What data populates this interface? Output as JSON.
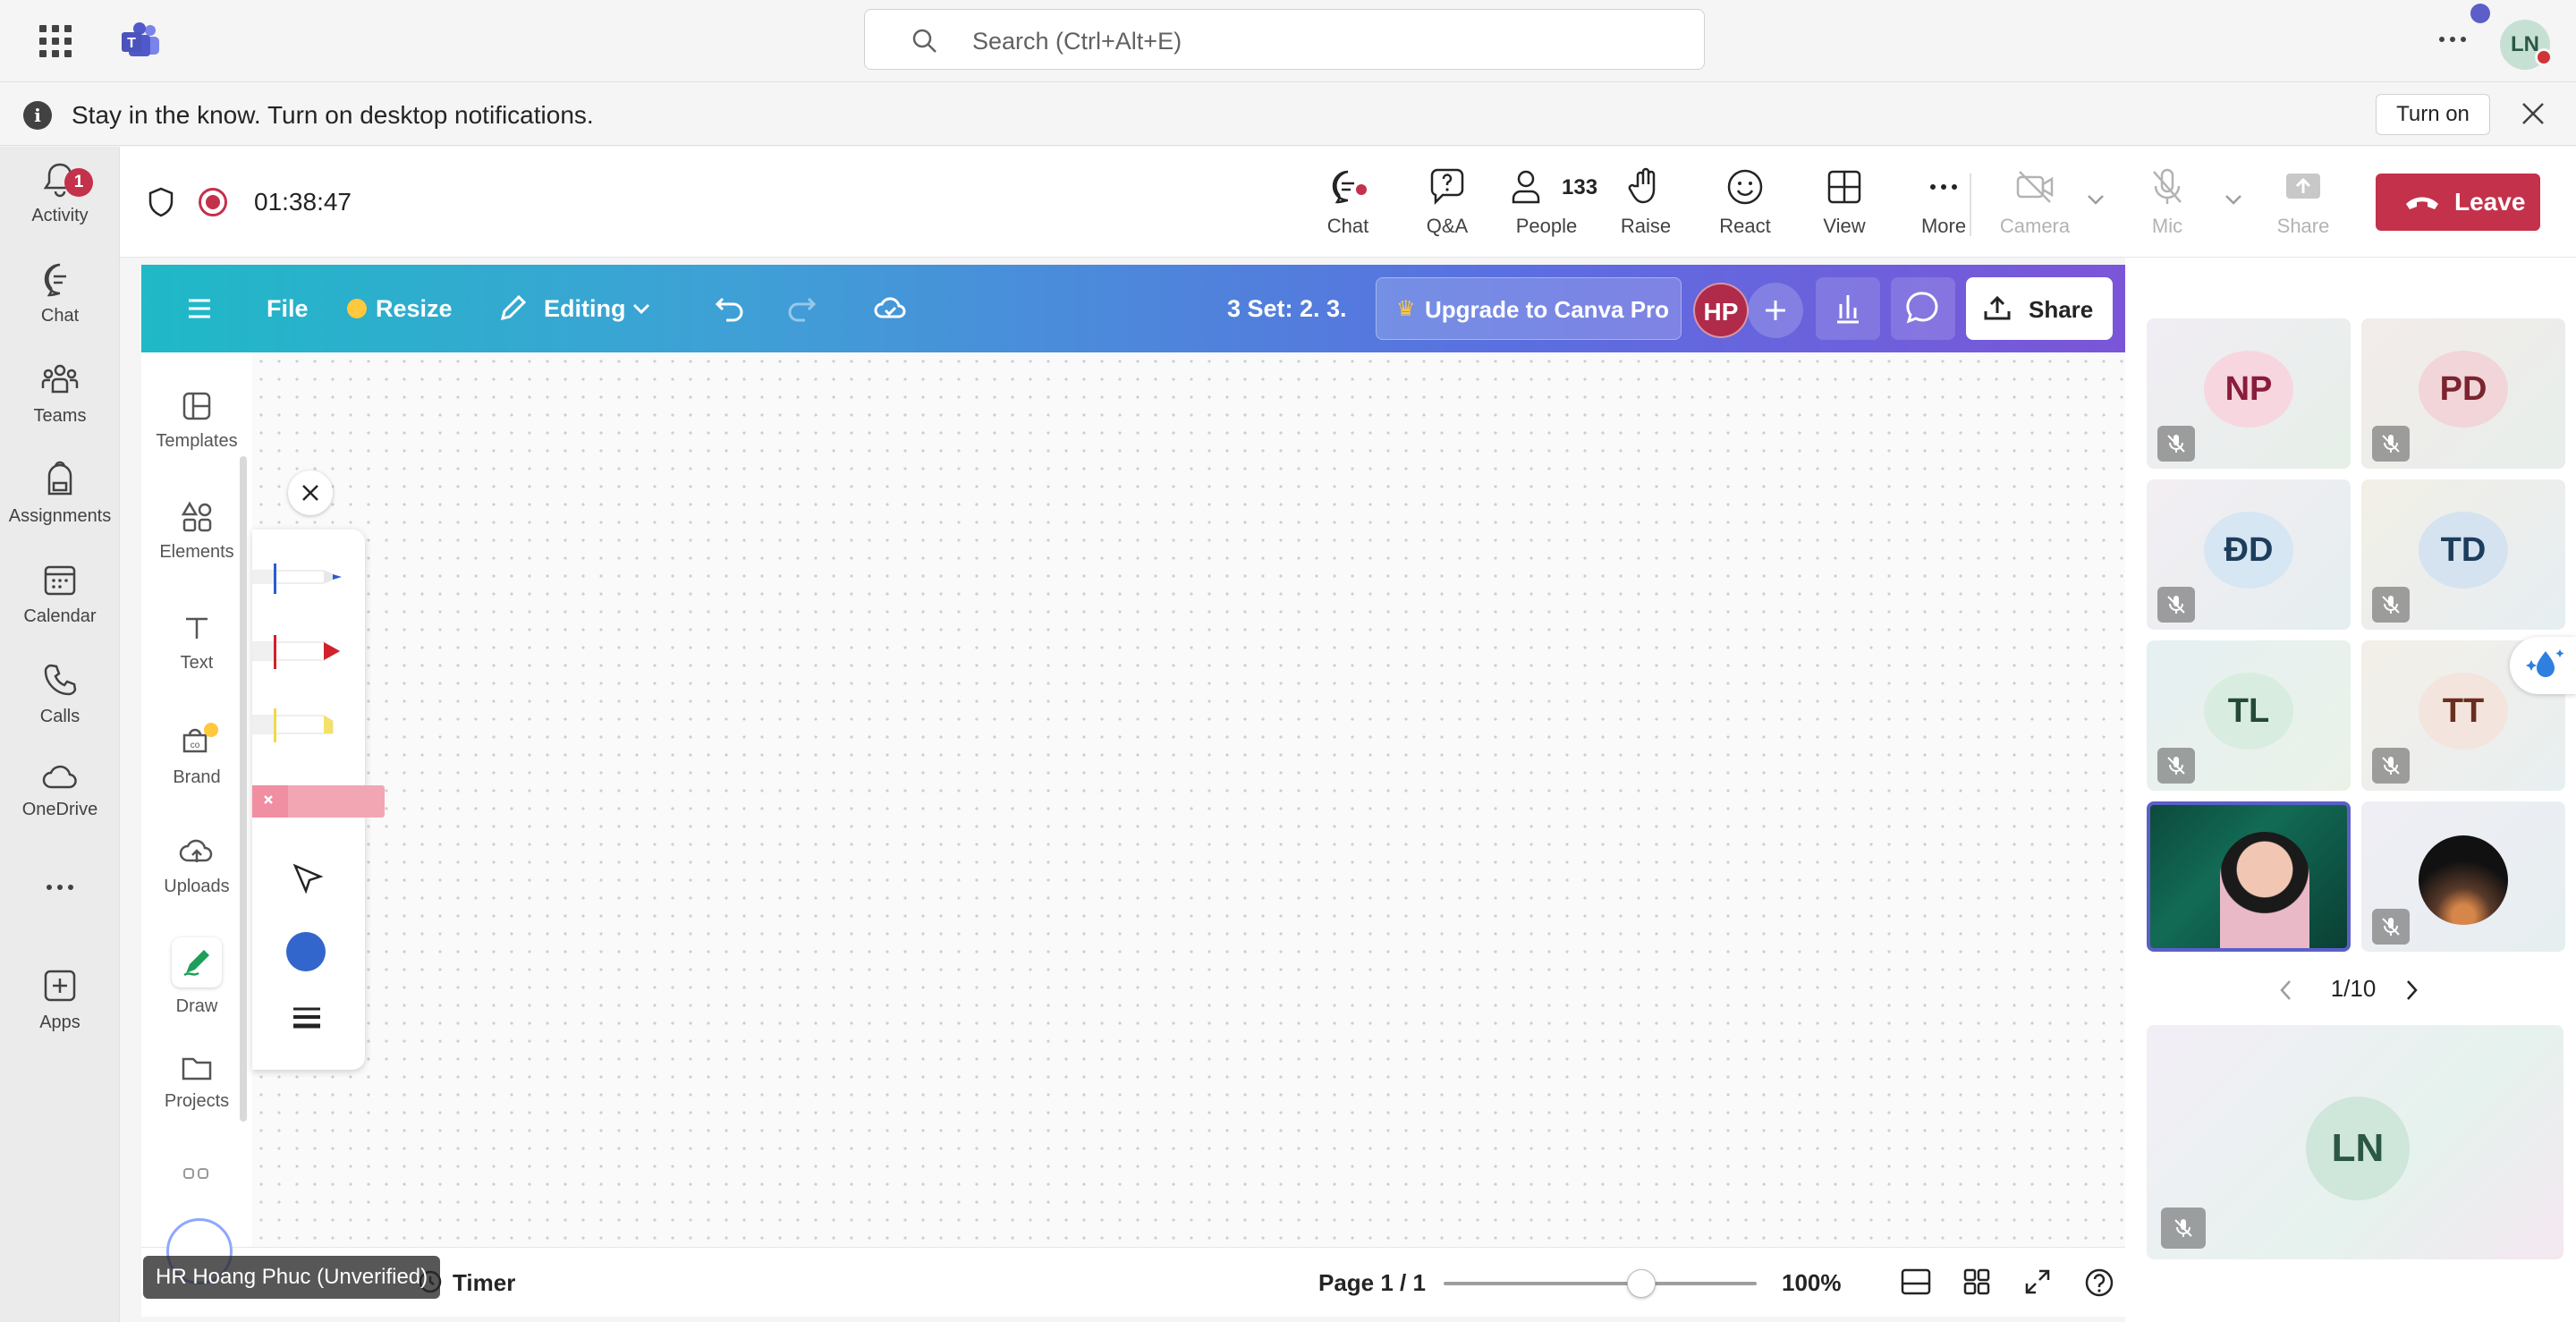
{
  "topbar": {
    "search_placeholder": "Search (Ctrl+Alt+E)",
    "user_initials": "LN"
  },
  "notification": {
    "text": "Stay in the know. Turn on desktop notifications.",
    "button": "Turn on"
  },
  "rail": {
    "items": [
      {
        "label": "Activity",
        "icon": "bell-icon",
        "badge": "1"
      },
      {
        "label": "Chat",
        "icon": "chat-icon"
      },
      {
        "label": "Teams",
        "icon": "teams-icon"
      },
      {
        "label": "Assignments",
        "icon": "backpack-icon"
      },
      {
        "label": "Calendar",
        "icon": "calendar-icon"
      },
      {
        "label": "Calls",
        "icon": "phone-icon"
      },
      {
        "label": "OneDrive",
        "icon": "cloud-icon"
      },
      {
        "label": "Apps",
        "icon": "plus-square-icon"
      }
    ]
  },
  "meeting": {
    "timer": "01:38:47",
    "toolbar": {
      "chat": "Chat",
      "qa": "Q&A",
      "people": "People",
      "people_count": "133",
      "raise": "Raise",
      "react": "React",
      "view": "View",
      "more": "More",
      "camera": "Camera",
      "mic": "Mic",
      "share": "Share",
      "leave": "Leave"
    }
  },
  "canva": {
    "topbar": {
      "file": "File",
      "resize": "Resize",
      "editing": "Editing",
      "title": "3 Set: 2. 3.",
      "upgrade": "Upgrade to Canva Pro",
      "collaborator_initials": "HP",
      "share": "Share"
    },
    "sidebar": [
      {
        "label": "Templates",
        "icon": "templates-icon"
      },
      {
        "label": "Elements",
        "icon": "elements-icon"
      },
      {
        "label": "Text",
        "icon": "text-icon"
      },
      {
        "label": "Brand",
        "icon": "brand-icon"
      },
      {
        "label": "Uploads",
        "icon": "upload-cloud-icon"
      },
      {
        "label": "Draw",
        "icon": "draw-icon"
      },
      {
        "label": "Projects",
        "icon": "folder-icon"
      }
    ],
    "draw_tools": [
      "pen-blue",
      "marker-red",
      "highlighter-yellow",
      "eraser-pink",
      "select-arrow"
    ],
    "draw_color": "#3366cc",
    "bottom": {
      "timer": "Timer",
      "page": "Page 1 / 1",
      "zoom": "100%",
      "zoom_slider_fraction": 0.63
    },
    "name_tag": "HR Hoang Phuc (Unverified)"
  },
  "gallery": {
    "participants": [
      {
        "initials": "NP",
        "bg": "#f7d6e0",
        "fg": "#8a1c3c",
        "muted": true
      },
      {
        "initials": "PD",
        "bg": "#f2d5d8",
        "fg": "#7a2430",
        "muted": true
      },
      {
        "initials": "ĐD",
        "bg": "#d6e6f2",
        "fg": "#1d3d5c",
        "muted": true
      },
      {
        "initials": "TD",
        "bg": "#d5e3f0",
        "fg": "#1d3d5c",
        "muted": true
      },
      {
        "initials": "TL",
        "bg": "#d8ece0",
        "fg": "#234a35",
        "muted": true
      },
      {
        "initials": "TT",
        "bg": "#f4e4de",
        "fg": "#6a2e1e",
        "muted": true
      }
    ],
    "page": "1/10",
    "self_initials": "LN"
  }
}
